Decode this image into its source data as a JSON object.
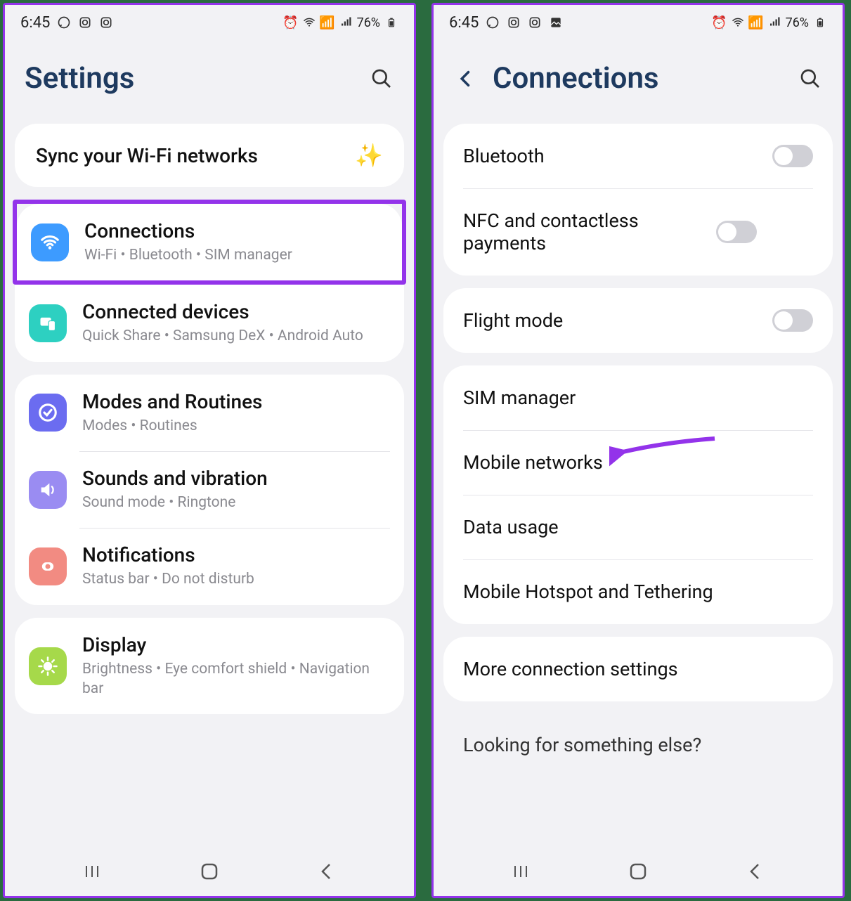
{
  "status": {
    "time": "6:45",
    "battery": "76%"
  },
  "left": {
    "title": "Settings",
    "sync": "Sync your Wi-Fi networks",
    "items": [
      {
        "title": "Connections",
        "sub": "Wi-Fi  •  Bluetooth  •  SIM manager",
        "color": "#3d9bff",
        "icon": "wifi"
      },
      {
        "title": "Connected devices",
        "sub": "Quick Share  •  Samsung DeX  •  Android Auto",
        "color": "#2dd0c1",
        "icon": "devices"
      },
      {
        "title": "Modes and Routines",
        "sub": "Modes  •  Routines",
        "color": "#6b6cf0",
        "icon": "target"
      },
      {
        "title": "Sounds and vibration",
        "sub": "Sound mode  •  Ringtone",
        "color": "#9a8cf2",
        "icon": "sound"
      },
      {
        "title": "Notifications",
        "sub": "Status bar  •  Do not disturb",
        "color": "#f28b82",
        "icon": "bell"
      },
      {
        "title": "Display",
        "sub": "Brightness  •  Eye comfort shield  •  Navigation bar",
        "color": "#a6d94a",
        "icon": "sun"
      }
    ]
  },
  "right": {
    "title": "Connections",
    "rows": [
      {
        "label": "Bluetooth",
        "toggle": true
      },
      {
        "label": "NFC and contactless payments",
        "toggle": true
      },
      {
        "label": "Flight mode",
        "toggle": true
      },
      {
        "label": "SIM manager",
        "toggle": false
      },
      {
        "label": "Mobile networks",
        "toggle": false
      },
      {
        "label": "Data usage",
        "toggle": false
      },
      {
        "label": "Mobile Hotspot and Tethering",
        "toggle": false
      },
      {
        "label": "More connection settings",
        "toggle": false
      }
    ],
    "looking": "Looking for something else?"
  }
}
